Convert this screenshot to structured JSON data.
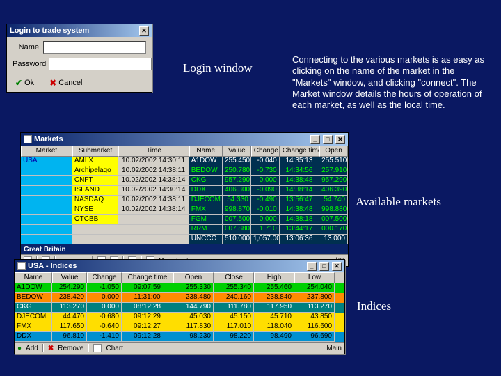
{
  "login": {
    "title": "Login to trade system",
    "name_label": "Name",
    "password_label": "Password",
    "ok_label": "Ok",
    "cancel_label": "Cancel"
  },
  "captions": {
    "login": "Login window",
    "desc": "Connecting to the various markets is as easy as clicking on the name of the market in the \"Markets\" window, and clicking \"connect\". The Market window details the hours of operation of each market, as well as the local time.",
    "markets": "Available markets",
    "indices": "Indices"
  },
  "markets": {
    "title": "Markets",
    "headers": [
      "Market",
      "Submarket",
      "Time",
      "Name",
      "Value",
      "Change",
      "Change time",
      "Open"
    ],
    "region1": "USA",
    "region2": "Great Britain",
    "rows": [
      {
        "sub": "AMLX",
        "time": "10.02/2002 14:30:11",
        "name": "A1DOW",
        "val": "255.450",
        "chg": "-0.040",
        "ctime": "14:35:13",
        "open": "255.510",
        "white": true
      },
      {
        "sub": "Archipelago",
        "time": "10.02/2002 14:38:11",
        "name": "BEDOW",
        "val": "250.780",
        "chg": "-0.730",
        "ctime": "14:34:56",
        "open": "257.910"
      },
      {
        "sub": "CNFT",
        "time": "10.02/2002 14:38:14",
        "name": "CKG",
        "val": "957.290",
        "chg": "0.000",
        "ctime": "14:38:48",
        "open": "957.290"
      },
      {
        "sub": "ISLAND",
        "time": "10.02/2002 14:30:14",
        "name": "DDX",
        "val": "406.300",
        "chg": "-0.090",
        "ctime": "14:38:14",
        "open": "406.390"
      },
      {
        "sub": "NASDAQ",
        "time": "10.02/2002 14:38:11",
        "name": "DJECOM",
        "val": "54.330",
        "chg": "-0.490",
        "ctime": "13:56:47",
        "open": "54.740"
      },
      {
        "sub": "NYSE",
        "time": "10.02/2002 14:38:14",
        "name": "FMX",
        "val": "998.870",
        "chg": "-0.010",
        "ctime": "14:38:48",
        "open": "998.880"
      },
      {
        "sub": "OTCBB",
        "time": "",
        "name": "FGM",
        "val": "007.500",
        "chg": "0.000",
        "ctime": "14:38:18",
        "open": "007.500"
      },
      {
        "sub": "",
        "time": "",
        "name": "RRM",
        "val": "007.880",
        "chg": "1.710",
        "ctime": "13:44:17",
        "open": "000.170"
      },
      {
        "sub": "",
        "time": "",
        "name": "UNCCO",
        "val": "510.000",
        "chg": "1,057.000",
        "ctime": "13:06:36",
        "open": "13.000",
        "white": true
      }
    ],
    "statusbar_right": "kth"
  },
  "indices": {
    "title": "USA - Indices",
    "headers": [
      "Name",
      "Value",
      "Change",
      "Change time",
      "Open",
      "Close",
      "High",
      "Low"
    ],
    "rows": [
      {
        "cls": "r-green",
        "name": "A1DOW",
        "val": "254.290",
        "chg": "-1.050",
        "ctime": "09:07:59",
        "open": "255.330",
        "close": "255.340",
        "high": "255.460",
        "low": "254.040"
      },
      {
        "cls": "r-orange",
        "name": "BEDOW",
        "val": "238.420",
        "chg": "0.000",
        "ctime": "11:31:00",
        "open": "238.480",
        "close": "240.160",
        "high": "238.840",
        "low": "237.800"
      },
      {
        "cls": "r-teal",
        "name": "CKG",
        "val": "113.270",
        "chg": "0.000",
        "ctime": "08:12:28",
        "open": "144.790",
        "close": "111.780",
        "high": "117.950",
        "low": "113.270"
      },
      {
        "cls": "r-yellow",
        "name": "DJECOM",
        "val": "44.470",
        "chg": "-0.680",
        "ctime": "09:12:29",
        "open": "45.030",
        "close": "45.150",
        "high": "45.710",
        "low": "43.850"
      },
      {
        "cls": "r-yellow",
        "name": "FMX",
        "val": "117.650",
        "chg": "-0.640",
        "ctime": "09:12:27",
        "open": "117.830",
        "close": "117.010",
        "high": "118.040",
        "low": "116.600"
      },
      {
        "cls": "r-blue",
        "name": "DDX",
        "val": "96.810",
        "chg": "-1.410",
        "ctime": "09:12:28",
        "open": "98.230",
        "close": "98.220",
        "high": "98.490",
        "low": "96.690"
      }
    ],
    "add_label": "Add",
    "remove_label": "Remove",
    "chart_label": "Chart",
    "main_label": "Main"
  }
}
